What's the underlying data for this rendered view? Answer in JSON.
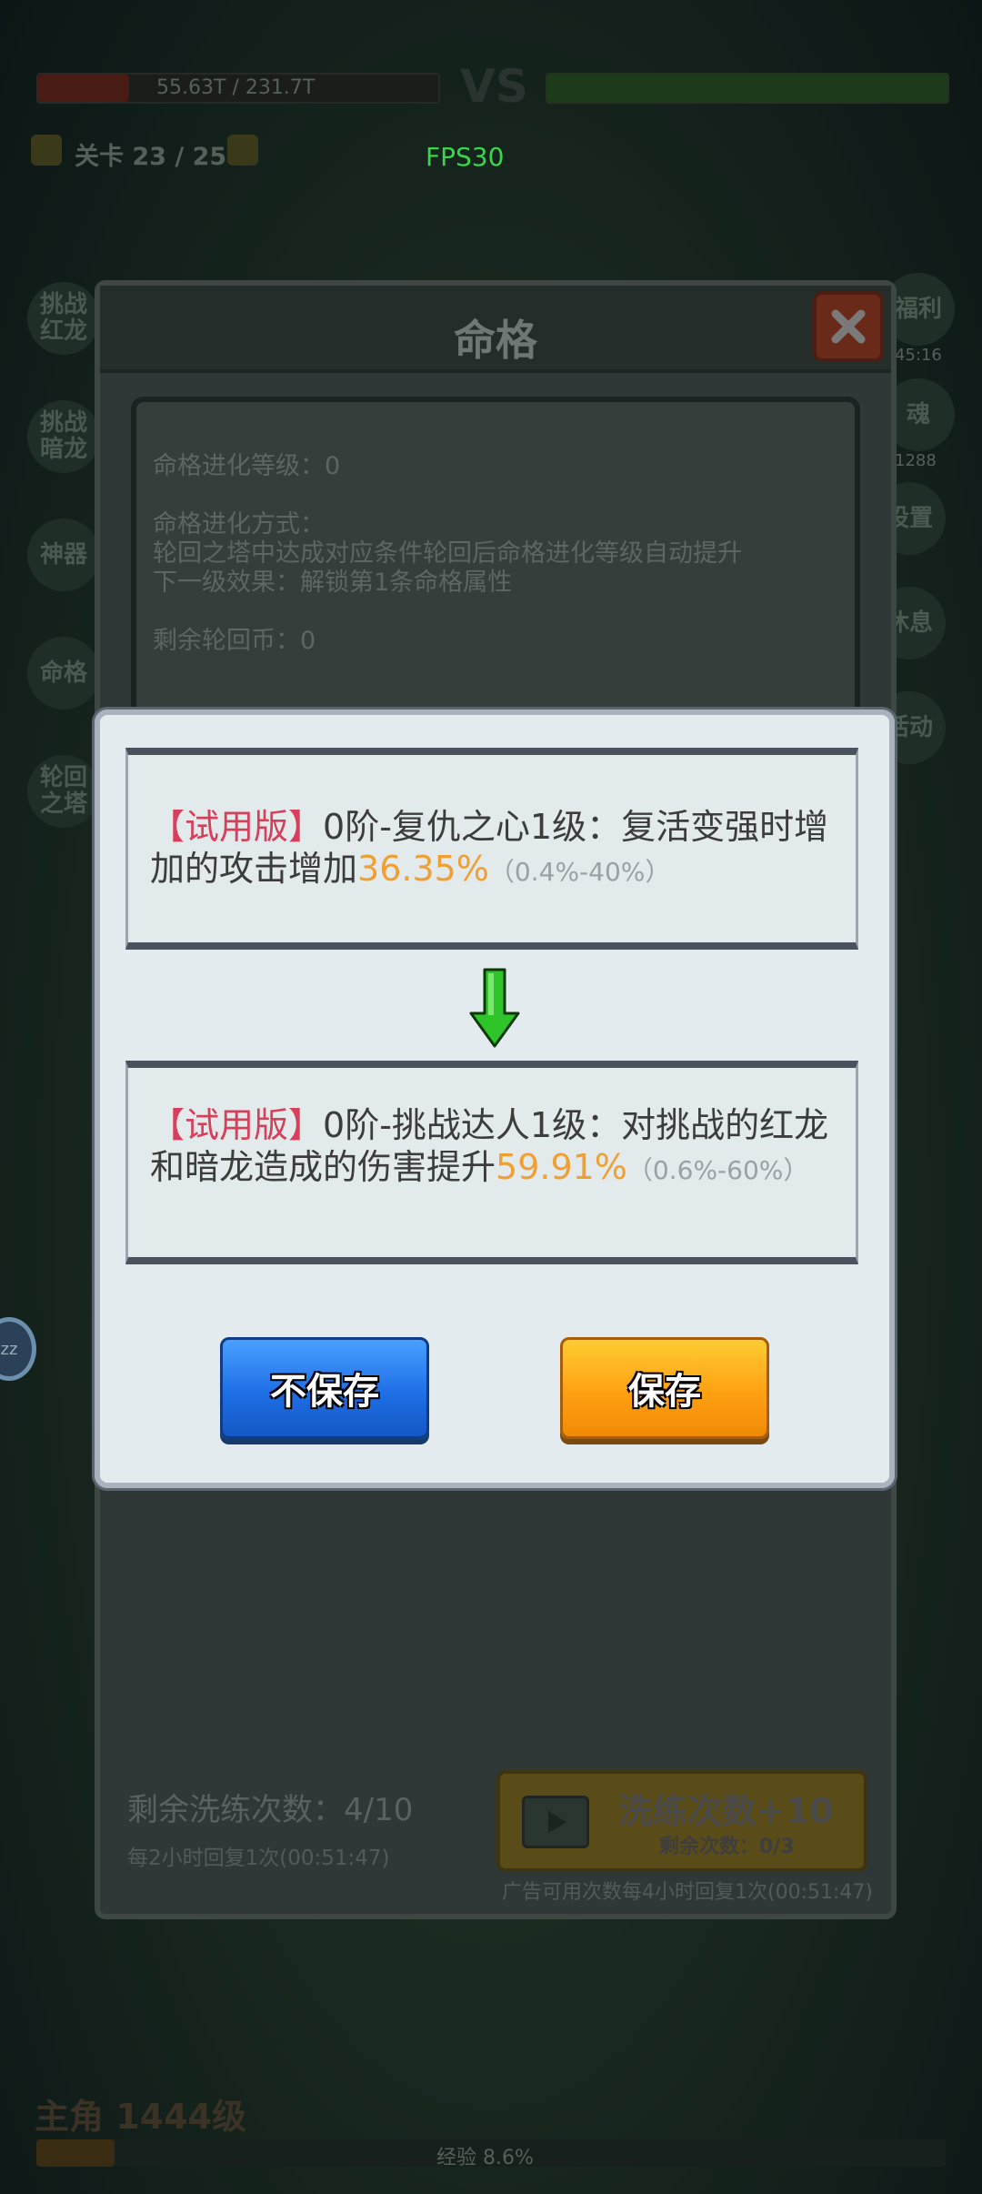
{
  "hud": {
    "player_hp": "55.63T / 231.7T",
    "vs": "VS",
    "enemy_hp": "",
    "stage_label": "关卡 23 / 25",
    "fps": "FPS30",
    "side_left": [
      "挑战红龙",
      "挑战暗龙",
      "神器",
      "命格",
      "轮回之塔"
    ],
    "side_right": [
      "福利",
      "魂",
      "设置",
      "休息",
      "活动"
    ],
    "timer_right": "45:16",
    "count_right": "1288",
    "bottom_level": "主角 1444级",
    "bottom_exp": "经验 8.6%",
    "sleep_badge": "zz"
  },
  "back_panel": {
    "title": "命格",
    "info": {
      "evolve_level": "命格进化等级：0",
      "evolve_method_label": "命格进化方式：",
      "evolve_method": "轮回之塔中达成对应条件轮回后命格进化等级自动提升",
      "next_effect": "下一级效果：解锁第1条命格属性",
      "coins": "剩余轮回币：0"
    },
    "wash_count": "剩余洗练次数：4/10",
    "wash_recover": "每2小时回复1次(00:51:47)",
    "ad_button": {
      "main": "洗练次数+10",
      "sub": "剩余次数：0/3"
    },
    "ad_note": "广告可用次数每4小时回复1次(00:51:47)"
  },
  "dialog": {
    "old": {
      "tag": "【试用版】",
      "text": "0阶-复仇之心1级：复活变强时增加的攻击增加",
      "percent": "36.35%",
      "range": "（0.4%-40%）"
    },
    "new": {
      "tag": "【试用版】",
      "text": "0阶-挑战达人1级：对挑战的红龙和暗龙造成的伤害提升",
      "percent": "59.91%",
      "range": "（0.6%-60%）"
    },
    "no_save_label": "不保存",
    "save_label": "保存"
  },
  "colors": {
    "tag": "#d6405c",
    "percent": "#f09f34",
    "arrow": "#2fc42a",
    "no_save": "#1e6fe6",
    "save": "#ffa012"
  }
}
